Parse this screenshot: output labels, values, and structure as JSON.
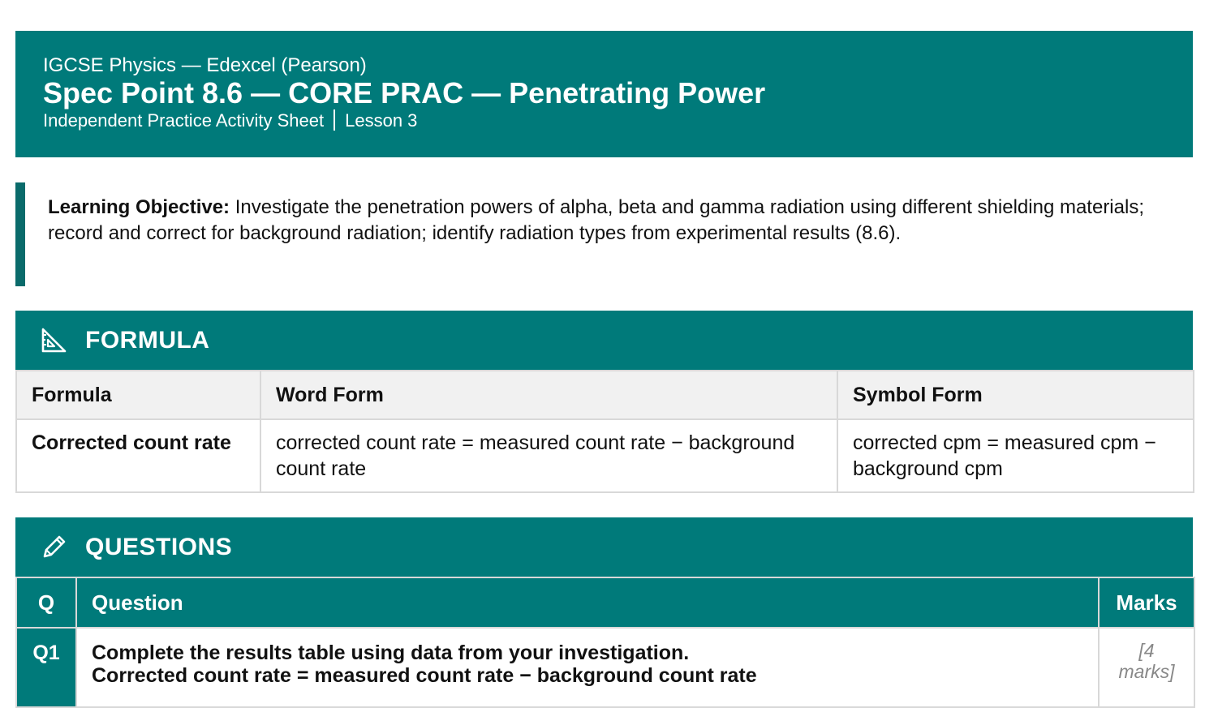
{
  "header": {
    "subject": "IGCSE Physics — Edexcel (Pearson)",
    "title": "Spec Point 8.6 — CORE PRAC — Penetrating Power",
    "sheet_type": "Independent Practice Activity Sheet",
    "lesson": "Lesson 3"
  },
  "objective": {
    "label": "Learning Objective:",
    "text": " Investigate the penetration powers of alpha, beta and gamma radiation using different shielding materials; record and correct for background radiation; identify radiation types from experimental results (8.6)."
  },
  "formula_section": {
    "title": "FORMULA",
    "icon": "set-square-icon",
    "columns": [
      "Formula",
      "Word Form",
      "Symbol Form"
    ],
    "rows": [
      {
        "name": "Corrected count rate",
        "word": "corrected count rate = measured count rate − background count rate",
        "symbol": "corrected cpm = measured cpm − background cpm"
      }
    ]
  },
  "questions_section": {
    "title": "QUESTIONS",
    "icon": "pencil-icon",
    "columns": [
      "Q",
      "Question",
      "Marks"
    ],
    "rows": [
      {
        "q": "Q1",
        "line1": "Complete the results table using data from your investigation.",
        "line2": "Corrected count rate = measured count rate − background count rate",
        "marks": "[4 marks]"
      }
    ]
  },
  "colors": {
    "teal": "#007a7a",
    "accent_bar": "#0a6b6b",
    "header_grey": "#f1f1f1"
  }
}
